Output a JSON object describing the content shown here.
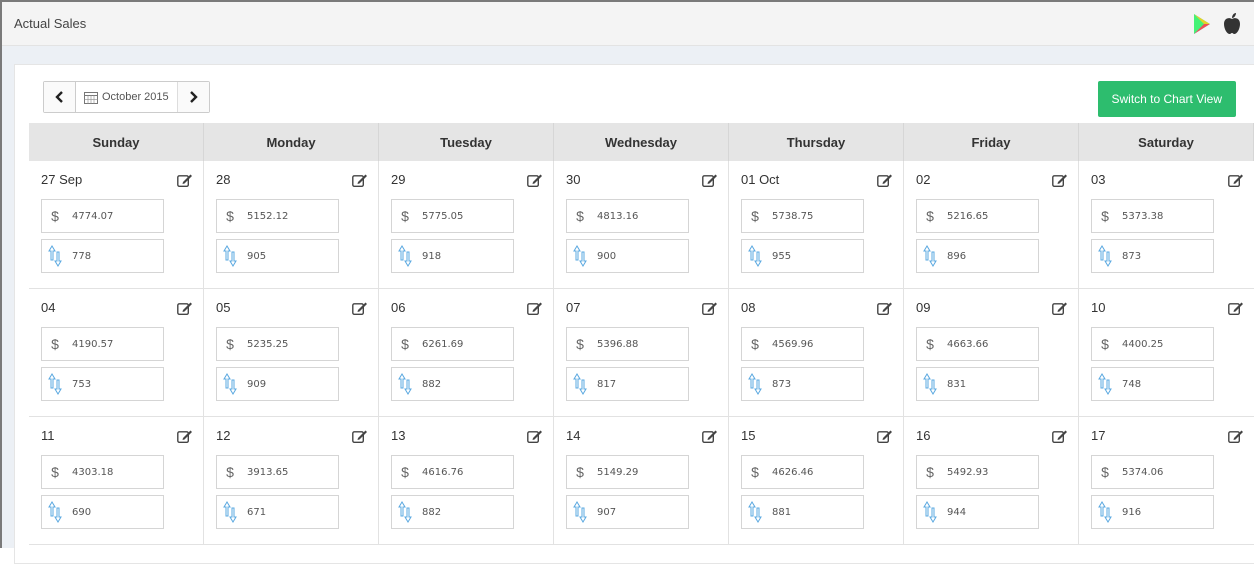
{
  "header": {
    "title": "Actual Sales"
  },
  "toolbar": {
    "month_label": "October 2015",
    "chart_button_label": "Switch to Chart View"
  },
  "colors": {
    "accent_green": "#2dbd6e",
    "icon_blue": "#5aa8e0"
  },
  "calendar": {
    "weekdays": [
      "Sunday",
      "Monday",
      "Tuesday",
      "Wednesday",
      "Thursday",
      "Friday",
      "Saturday"
    ],
    "weeks": [
      [
        {
          "date": "27 Sep",
          "sales": "4774.07",
          "count": "778"
        },
        {
          "date": "28",
          "sales": "5152.12",
          "count": "905"
        },
        {
          "date": "29",
          "sales": "5775.05",
          "count": "918"
        },
        {
          "date": "30",
          "sales": "4813.16",
          "count": "900"
        },
        {
          "date": "01 Oct",
          "sales": "5738.75",
          "count": "955"
        },
        {
          "date": "02",
          "sales": "5216.65",
          "count": "896"
        },
        {
          "date": "03",
          "sales": "5373.38",
          "count": "873"
        }
      ],
      [
        {
          "date": "04",
          "sales": "4190.57",
          "count": "753"
        },
        {
          "date": "05",
          "sales": "5235.25",
          "count": "909"
        },
        {
          "date": "06",
          "sales": "6261.69",
          "count": "882"
        },
        {
          "date": "07",
          "sales": "5396.88",
          "count": "817"
        },
        {
          "date": "08",
          "sales": "4569.96",
          "count": "873"
        },
        {
          "date": "09",
          "sales": "4663.66",
          "count": "831"
        },
        {
          "date": "10",
          "sales": "4400.25",
          "count": "748"
        }
      ],
      [
        {
          "date": "11",
          "sales": "4303.18",
          "count": "690"
        },
        {
          "date": "12",
          "sales": "3913.65",
          "count": "671"
        },
        {
          "date": "13",
          "sales": "4616.76",
          "count": "882"
        },
        {
          "date": "14",
          "sales": "5149.29",
          "count": "907"
        },
        {
          "date": "15",
          "sales": "4626.46",
          "count": "881"
        },
        {
          "date": "16",
          "sales": "5492.93",
          "count": "944"
        },
        {
          "date": "17",
          "sales": "5374.06",
          "count": "916"
        }
      ]
    ],
    "currency_symbol": "$"
  }
}
